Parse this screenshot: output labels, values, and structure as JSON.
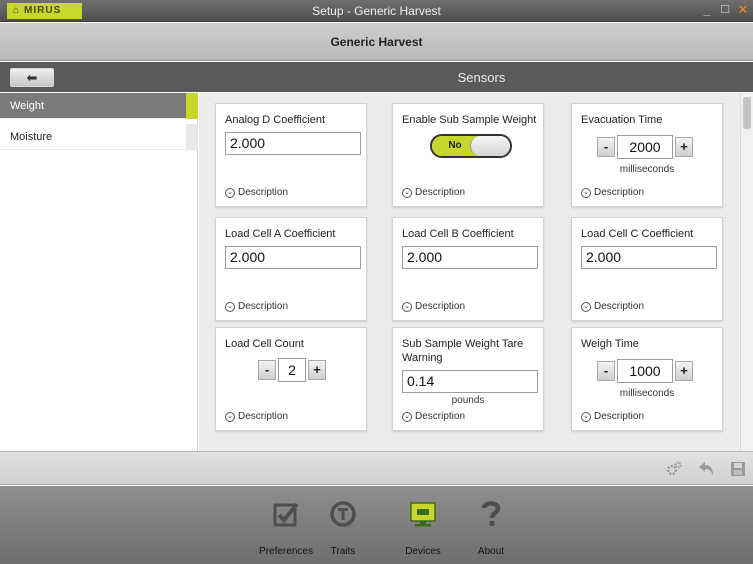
{
  "app": {
    "logo_text": "MIRUS",
    "window_title": "Setup - Generic Harvest",
    "accent_color": "#c8d62b"
  },
  "header": {
    "title": "Generic Harvest"
  },
  "section_bar": {
    "title": "Sensors",
    "back_icon": "arrow-left-icon"
  },
  "sidebar": {
    "items": [
      {
        "label": "Weight",
        "selected": true
      },
      {
        "label": "Moisture",
        "selected": false
      }
    ]
  },
  "cards": {
    "analog_d": {
      "title": "Analog D Coefficient",
      "value": "2.000",
      "desc": "Description"
    },
    "sub_sample_enable": {
      "title": "Enable Sub Sample Weight",
      "toggle_label": "No",
      "desc": "Description"
    },
    "evacuation_time": {
      "title": "Evacuation Time",
      "minus": "-",
      "value": "2000",
      "plus": "+",
      "unit": "milliseconds",
      "desc": "Description"
    },
    "load_cell_a": {
      "title": "Load Cell A Coefficient",
      "value": "2.000",
      "desc": "Description"
    },
    "load_cell_b": {
      "title": "Load Cell B Coefficient",
      "value": "2.000",
      "desc": "Description"
    },
    "load_cell_c": {
      "title": "Load Cell C Coefficient",
      "value": "2.000",
      "desc": "Description"
    },
    "load_cell_count": {
      "title": "Load Cell Count",
      "minus": "-",
      "value": "2",
      "plus": "+",
      "desc": "Description"
    },
    "sub_sample_tare": {
      "title": "Sub Sample Weight Tare Warning",
      "value": "0.14",
      "unit": "pounds",
      "desc": "Description"
    },
    "weigh_time": {
      "title": "Weigh Time",
      "minus": "-",
      "value": "1000",
      "plus": "+",
      "unit": "milliseconds",
      "desc": "Description"
    }
  },
  "action_bar": {
    "icons": [
      "gears-icon",
      "undo-icon",
      "save-icon"
    ]
  },
  "bottom_nav": {
    "items": [
      {
        "label": "Preferences",
        "icon": "checkbox-icon"
      },
      {
        "label": "Traits",
        "icon": "traits-icon"
      },
      {
        "label": "Devices",
        "icon": "monitor-icon"
      },
      {
        "label": "About",
        "icon": "question-icon"
      }
    ]
  }
}
